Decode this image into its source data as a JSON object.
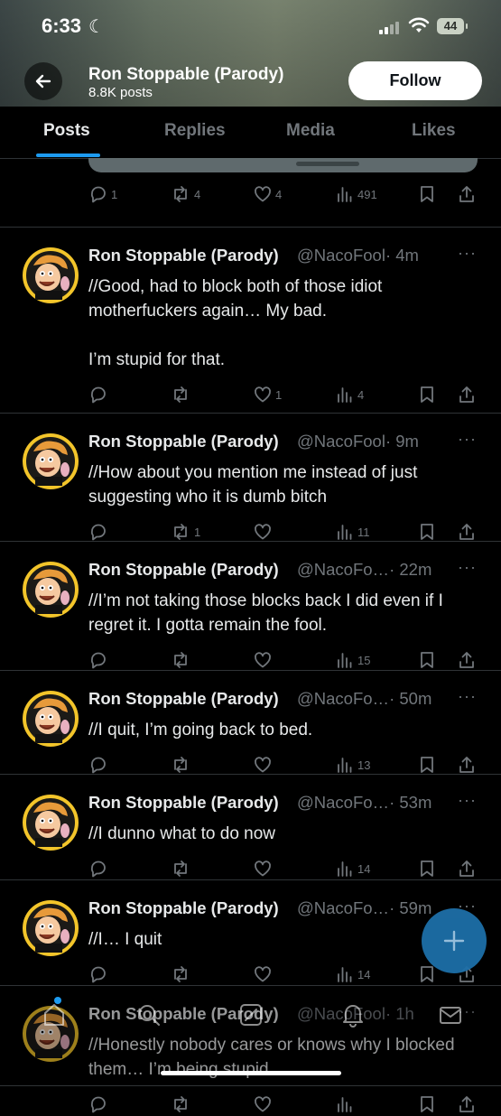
{
  "status_bar": {
    "time": "6:33",
    "battery": "44"
  },
  "header": {
    "name": "Ron Stoppable (Parody)",
    "post_count": "8.8K posts",
    "follow_label": "Follow"
  },
  "tabs": [
    {
      "label": "Posts"
    },
    {
      "label": "Replies"
    },
    {
      "label": "Media"
    },
    {
      "label": "Likes"
    }
  ],
  "previous_post": {
    "replies": "1",
    "reposts": "4",
    "likes": "4",
    "views": "491"
  },
  "posts": [
    {
      "name": "Ron Stoppable (Parody)",
      "handle": "@NacoFool",
      "time": "· 4m",
      "text": "//Good, had to block both of those idiot motherfuckers again… My bad.\n\nI’m stupid for that.",
      "replies": "",
      "reposts": "",
      "likes": "1",
      "views": "4"
    },
    {
      "name": "Ron Stoppable (Parody)",
      "handle": "@NacoFool",
      "time": "· 9m",
      "text": "//How about you mention me instead of just suggesting who it is dumb bitch",
      "replies": "",
      "reposts": "1",
      "likes": "",
      "views": "11"
    },
    {
      "name": "Ron Stoppable (Parody)",
      "handle": "@NacoFo…",
      "time": "· 22m",
      "text": "//I’m not taking those blocks back I did even if I regret it. I gotta remain the fool.",
      "replies": "",
      "reposts": "",
      "likes": "",
      "views": "15"
    },
    {
      "name": "Ron Stoppable (Parody)",
      "handle": "@NacoFo…",
      "time": "· 50m",
      "text": "//I quit, I’m going back to bed.",
      "replies": "",
      "reposts": "",
      "likes": "",
      "views": "13"
    },
    {
      "name": "Ron Stoppable (Parody)",
      "handle": "@NacoFo…",
      "time": "· 53m",
      "text": "//I dunno what to do now",
      "replies": "",
      "reposts": "",
      "likes": "",
      "views": "14"
    },
    {
      "name": "Ron Stoppable (Parody)",
      "handle": "@NacoFo…",
      "time": "· 59m",
      "text": "//I… I quit",
      "replies": "",
      "reposts": "",
      "likes": "",
      "views": "14"
    },
    {
      "name": "Ron Stoppable (Parody)",
      "handle": "@NacoFool",
      "time": "· 1h",
      "text": "//Honestly nobody cares or knows why I blocked them… I’m being stupid.",
      "replies": "",
      "reposts": "",
      "likes": "",
      "views": ""
    }
  ],
  "more_glyph": "···",
  "colors": {
    "accent": "#1d9bf0",
    "muted": "#71767b",
    "background": "#000000",
    "text": "#e7e9ea"
  },
  "icons": {
    "reply": "reply-icon",
    "repost": "repost-icon",
    "like": "heart-icon",
    "views": "views-icon",
    "bookmark": "bookmark-icon",
    "share": "share-icon",
    "back": "back-arrow-icon",
    "compose": "plus-icon"
  }
}
